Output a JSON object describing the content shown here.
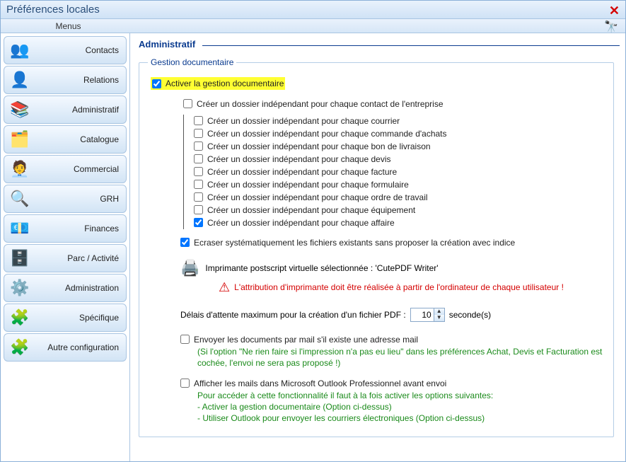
{
  "window": {
    "title": "Préférences locales",
    "menus_label": "Menus"
  },
  "sidebar": {
    "items": [
      {
        "label": "Contacts",
        "icon": "👥"
      },
      {
        "label": "Relations",
        "icon": "👤"
      },
      {
        "label": "Administratif",
        "icon": "📚"
      },
      {
        "label": "Catalogue",
        "icon": "🗂️"
      },
      {
        "label": "Commercial",
        "icon": "🧑‍💼"
      },
      {
        "label": "GRH",
        "icon": "🔍"
      },
      {
        "label": "Finances",
        "icon": "💶"
      },
      {
        "label": "Parc / Activité",
        "icon": "🗄️"
      },
      {
        "label": "Administration",
        "icon": "⚙️"
      },
      {
        "label": "Spécifique",
        "icon": "🧩"
      },
      {
        "label": "Autre configuration",
        "icon": "🧩"
      }
    ]
  },
  "main": {
    "title": "Administratif",
    "group_title": "Gestion documentaire",
    "activate_label": "Activer la gestion documentaire",
    "contact_folder_label": "Créer un dossier indépendant pour chaque contact de l'entreprise",
    "per_type": [
      "Créer un dossier indépendant pour chaque courrier",
      "Créer un dossier indépendant pour chaque commande d'achats",
      "Créer un dossier indépendant pour chaque bon de livraison",
      "Créer un dossier indépendant pour chaque devis",
      "Créer un dossier indépendant pour chaque facture",
      "Créer un dossier indépendant pour chaque formulaire",
      "Créer un dossier indépendant pour chaque ordre de travail",
      "Créer un dossier indépendant pour chaque équipement",
      "Créer un dossier indépendant pour chaque affaire"
    ],
    "per_type_checked": [
      false,
      false,
      false,
      false,
      false,
      false,
      false,
      false,
      true
    ],
    "overwrite_label": "Ecraser systématiquement les fichiers existants sans proposer la création avec indice",
    "printer_label": "Imprimante postscript virtuelle sélectionnée : 'CutePDF Writer'",
    "printer_warning": "L'attribution d'imprimante doit être réalisée à partir de l'ordinateur de chaque utilisateur !",
    "delay_label_before": "Délais d'attente maximum pour la création d'un fichier PDF :",
    "delay_value": "10",
    "delay_label_after": "seconde(s)",
    "mail_label": "Envoyer les documents par mail s'il existe une adresse mail",
    "mail_note": "(Si l'option \"Ne rien faire si l'impression n'a pas eu lieu\" dans les préférences Achat, Devis et Facturation est cochée, l'envoi ne sera pas proposé !)",
    "outlook_label": "Afficher les mails dans Microsoft Outlook Professionnel avant envoi",
    "outlook_note_title": "Pour accéder à cette fonctionnalité il faut à la fois activer les options suivantes:",
    "outlook_note_1": " - Activer la gestion documentaire (Option ci-dessus)",
    "outlook_note_2": " - Utiliser Outlook pour envoyer les courriers électroniques (Option ci-dessus)"
  }
}
